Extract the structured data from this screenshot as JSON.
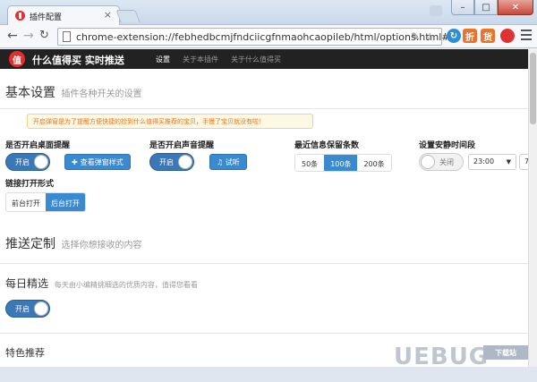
{
  "browser": {
    "tab_title": "插件配置",
    "tab_close": "×",
    "url": "chrome-extension://febhedbcmjfndciicgfnmaohcaopileb/html/options.html#",
    "win_min": "–",
    "win_max": "□",
    "win_close": "✕",
    "ext_zhi": "折",
    "ext_huo": "货",
    "ext_zhi_color": "#e8742e",
    "ext_huo_color": "#e8742e",
    "ext_user_color": "#d33"
  },
  "navbar": {
    "logo": "值",
    "brand": "什么值得买 实时推送",
    "links": [
      "设置",
      "关于本插件",
      "关于什么值得买"
    ]
  },
  "basic": {
    "title": "基本设置",
    "subtitle": "插件各种开关的设置",
    "tip": "开启弹窗是为了提醒方便快捷的捡到什么值得买推荐的宝贝，手慢了宝贝就没有啦！",
    "desktop_label": "是否开启桌面提醒",
    "desktop_toggle": "开启",
    "desktop_button": "查看弹窗样式",
    "sound_label": "是否开启声音提醒",
    "sound_toggle": "开启",
    "sound_button": "试听",
    "keep_label": "最近信息保留条数",
    "keep_options": [
      "50条",
      "100条",
      "200条"
    ],
    "keep_selected": "100条",
    "quiet_label": "设置安静时间段",
    "quiet_toggle": "关闭",
    "quiet_start": "23:00",
    "quiet_end": "7",
    "link_label": "链接打开形式",
    "link_options": [
      "前台打开",
      "后台打开"
    ],
    "link_selected": "后台打开"
  },
  "push": {
    "title": "推送定制",
    "subtitle": "选择你想接收的内容",
    "daily_title": "每日精选",
    "daily_desc": "每天由小编精挑细选的优质内容，值得您看看",
    "daily_toggle": "开启",
    "featured_title": "特色推荐"
  },
  "watermark": {
    "text": "UEBUG",
    "sub": "下载站"
  }
}
